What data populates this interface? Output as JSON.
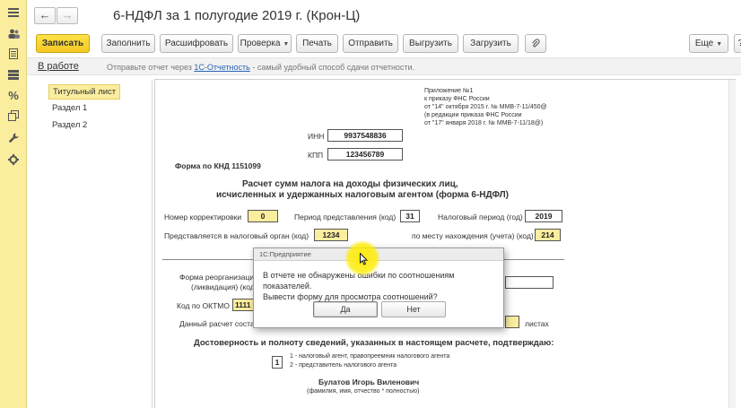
{
  "window": {
    "title": "6-НДФЛ за 1 полугодие 2019 г. (Крон-Ц)",
    "back_glyph": "←",
    "forward_glyph": "→"
  },
  "sidebar": {
    "icons": [
      "menu-icon",
      "users-icon",
      "document-icon",
      "list-icon",
      "percent-icon",
      "copy-icon",
      "wrench-icon",
      "settings-icon"
    ]
  },
  "toolbar": {
    "save": "Записать",
    "fill": "Заполнить",
    "decrypt": "Расшифровать",
    "check": "Проверка",
    "print": "Печать",
    "send": "Отправить",
    "upload": "Выгрузить",
    "load": "Загрузить",
    "more": "Еще",
    "help": "?"
  },
  "status": {
    "state_link": "В работе",
    "message_prefix": "Отправьте отчет через ",
    "message_link": "1С-Отчетность",
    "message_suffix": " - самый удобный способ сдачи отчетности."
  },
  "sections": [
    {
      "label": "Титульный лист",
      "active": true
    },
    {
      "label": "Раздел 1",
      "active": false
    },
    {
      "label": "Раздел 2",
      "active": false
    }
  ],
  "form": {
    "appendix": [
      "Приложение №1",
      "к приказу ФНС России",
      "от \"14\" октября 2015 г. № ММВ-7-11/450@",
      "(в редакции приказа ФНС России",
      "от \"17\" января 2018 г. № ММВ-7-11/18@)"
    ],
    "inn_label": "ИНН",
    "inn_value": "9937548836",
    "kpp_label": "КПП",
    "kpp_value": "123456789",
    "knd": "Форма по КНД 1151099",
    "heading_line1": "Расчет сумм налога на доходы физических лиц,",
    "heading_line2": "исчисленных и удержанных налоговым агентом (форма 6-НДФЛ)",
    "correction_label": "Номер корректировки",
    "correction_value": "0",
    "period_label": "Период представления (код)",
    "period_value": "31",
    "tax_period_label": "Налоговый период (год)",
    "tax_period_value": "2019",
    "tax_authority_label": "Представляется в налоговый орган (код)",
    "tax_authority_value": "1234",
    "location_label": "по месту нахождения (учета) (код)",
    "location_value": "214",
    "reorg_label_1": "Форма реорганизации",
    "reorg_label_2": "(ликвидация) (код)",
    "oktmo_label": "Код по ОКТМО",
    "oktmo_value": "1111",
    "pages_label": "Данный расчет состав",
    "sheets_label": "листах",
    "confirm_text": "Достоверность и полноту сведений, указанных в настоящем расчете, подтверждаю:",
    "signer_code": "1",
    "signer_option_1": "1 - налоговый агент, правопреемник налогового агента",
    "signer_option_2": "2 - представитель налогового агента",
    "signer_name": "Булатов Игорь Виленович",
    "signer_caption": "(фамилия, имя, отчество * полностью)"
  },
  "dialog": {
    "title": "1С:Предприятие",
    "message_line1": "В отчете не обнаружены ошибки по соотношениям показателей.",
    "message_line2": "Вывести форму для просмотра соотношений?",
    "yes": "Да",
    "no": "Нет"
  }
}
